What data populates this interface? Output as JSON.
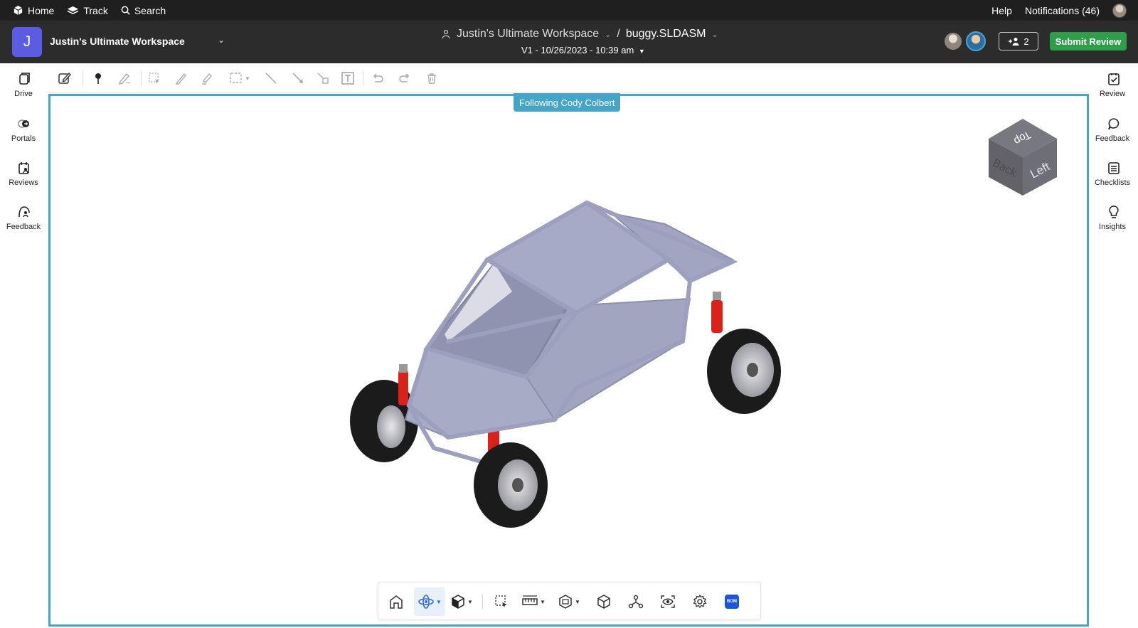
{
  "topnav": {
    "home": "Home",
    "track": "Track",
    "search": "Search",
    "help": "Help",
    "notifications": "Notifications (46)"
  },
  "header": {
    "workspace_initial": "J",
    "workspace_name": "Justin's Ultimate Workspace",
    "breadcrumb_workspace": "Justin's Ultimate Workspace",
    "breadcrumb_separator": "/",
    "file_name": "buggy.SLDASM",
    "version": "V1 - 10/26/2023 - 10:39 am",
    "share_count": "2",
    "submit_label": "Submit Review"
  },
  "left_rail": [
    {
      "label": "Drive",
      "icon": "drive-icon"
    },
    {
      "label": "Portals",
      "icon": "portals-icon"
    },
    {
      "label": "Reviews",
      "icon": "reviews-icon"
    },
    {
      "label": "Feedback",
      "icon": "feedback-icon"
    }
  ],
  "right_rail": [
    {
      "label": "Review",
      "icon": "review-check-icon"
    },
    {
      "label": "Feedback",
      "icon": "chat-bubble-icon"
    },
    {
      "label": "Checklists",
      "icon": "checklist-icon"
    },
    {
      "label": "Insights",
      "icon": "lightbulb-icon"
    }
  ],
  "viewport": {
    "following_label": "Following Cody Colbert",
    "view_cube": {
      "top": "Top",
      "left": "Left",
      "back": "Back"
    }
  },
  "bottom_toolbar": {
    "bom_label": "BOM"
  },
  "colors": {
    "accent_blue": "#45a5c8",
    "submit_green": "#2e9e4a",
    "workspace_purple": "#5b5ce2",
    "dark_bar": "#1f1f1f",
    "header_bar": "#2c2c2c"
  }
}
